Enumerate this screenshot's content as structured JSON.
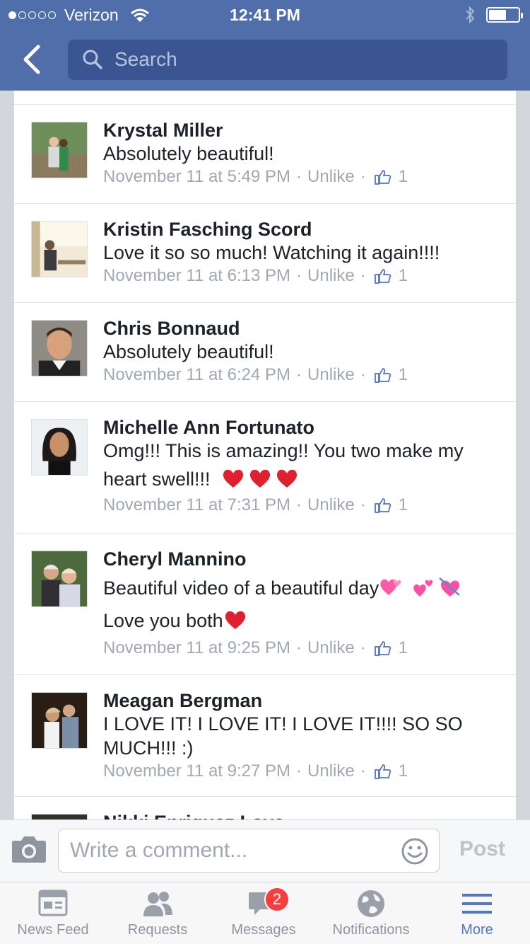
{
  "status_bar": {
    "carrier": "Verizon",
    "time": "12:41 PM"
  },
  "header": {
    "search_placeholder": "Search"
  },
  "comments": [
    {
      "name": "Krystal Miller",
      "text": "Absolutely beautiful!",
      "time": "November 11 at 5:49 PM",
      "action": "Unlike",
      "likes": "1"
    },
    {
      "name": "Kristin Fasching Scord",
      "text": "Love it so so much! Watching it again!!!!",
      "time": "November 11 at 6:13 PM",
      "action": "Unlike",
      "likes": "1"
    },
    {
      "name": "Chris Bonnaud",
      "text": "Absolutely beautiful!",
      "time": "November 11 at 6:24 PM",
      "action": "Unlike",
      "likes": "1"
    },
    {
      "name": "Michelle Ann Fortunato",
      "text_line1": "Omg!!! This is amazing!! You two make my",
      "text_line2": "heart swell!!!",
      "time": "November 11 at 7:31 PM",
      "action": "Unlike",
      "likes": "1"
    },
    {
      "name": "Cheryl Mannino",
      "text_line1": "Beautiful video of a beautiful day",
      "text_line2": "Love you both",
      "time": "November 11 at 9:25 PM",
      "action": "Unlike",
      "likes": "1"
    },
    {
      "name": "Meagan Bergman",
      "text_line1": "I LOVE IT! I LOVE IT! I LOVE IT!!!! SO SO",
      "text_line2": "MUCH!!! :)",
      "time": "November 11 at 9:27 PM",
      "action": "Unlike",
      "likes": "1"
    },
    {
      "name": "Nikki Enriquez Love"
    }
  ],
  "comment_bar": {
    "placeholder": "Write a comment...",
    "post_label": "Post"
  },
  "tabs": [
    {
      "label": "News Feed",
      "icon": "news-feed-icon"
    },
    {
      "label": "Requests",
      "icon": "requests-icon"
    },
    {
      "label": "Messages",
      "icon": "messages-icon",
      "badge": "2"
    },
    {
      "label": "Notifications",
      "icon": "globe-icon"
    },
    {
      "label": "More",
      "icon": "hamburger-icon",
      "active": true
    }
  ],
  "colors": {
    "brand": "#4f6eaa",
    "search_bg": "#3b5592",
    "active_tab": "#4f76c7",
    "badge": "#fa3e3e",
    "meta_text": "#a2a8b3"
  }
}
